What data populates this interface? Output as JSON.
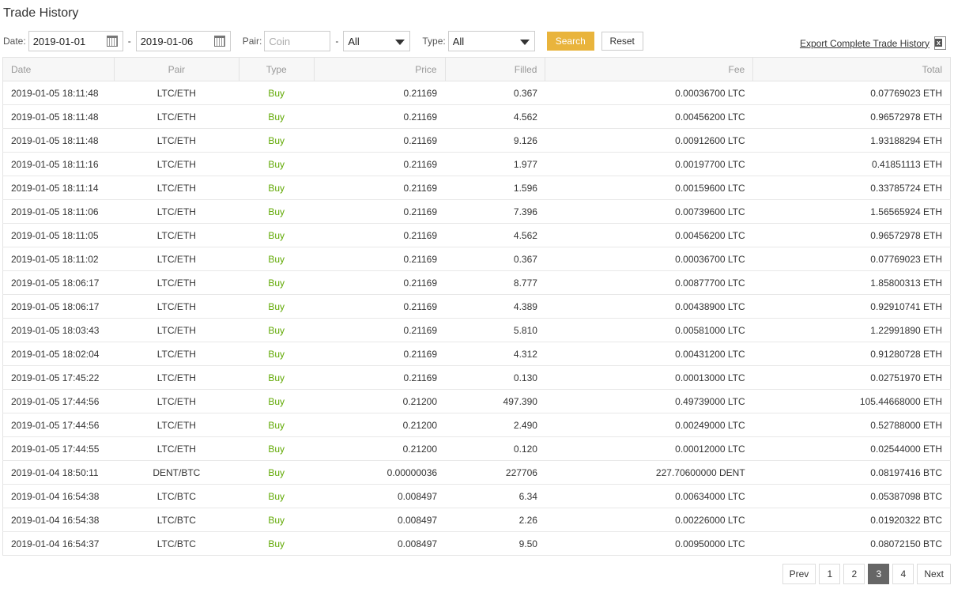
{
  "title": "Trade History",
  "filters": {
    "date_label": "Date:",
    "date_from": "2019-01-01",
    "date_to": "2019-01-06",
    "dash": "-",
    "pair_label": "Pair:",
    "coin_placeholder": "Coin",
    "pair_quote": "All",
    "type_label": "Type:",
    "type_value": "All",
    "search": "Search",
    "reset": "Reset"
  },
  "export_label": "Export Complete Trade History",
  "columns": [
    "Date",
    "Pair",
    "Type",
    "Price",
    "Filled",
    "Fee",
    "Total"
  ],
  "rows": [
    [
      "2019-01-05 18:11:48",
      "LTC/ETH",
      "Buy",
      "0.21169",
      "0.367",
      "0.00036700 LTC",
      "0.07769023 ETH"
    ],
    [
      "2019-01-05 18:11:48",
      "LTC/ETH",
      "Buy",
      "0.21169",
      "4.562",
      "0.00456200 LTC",
      "0.96572978 ETH"
    ],
    [
      "2019-01-05 18:11:48",
      "LTC/ETH",
      "Buy",
      "0.21169",
      "9.126",
      "0.00912600 LTC",
      "1.93188294 ETH"
    ],
    [
      "2019-01-05 18:11:16",
      "LTC/ETH",
      "Buy",
      "0.21169",
      "1.977",
      "0.00197700 LTC",
      "0.41851113 ETH"
    ],
    [
      "2019-01-05 18:11:14",
      "LTC/ETH",
      "Buy",
      "0.21169",
      "1.596",
      "0.00159600 LTC",
      "0.33785724 ETH"
    ],
    [
      "2019-01-05 18:11:06",
      "LTC/ETH",
      "Buy",
      "0.21169",
      "7.396",
      "0.00739600 LTC",
      "1.56565924 ETH"
    ],
    [
      "2019-01-05 18:11:05",
      "LTC/ETH",
      "Buy",
      "0.21169",
      "4.562",
      "0.00456200 LTC",
      "0.96572978 ETH"
    ],
    [
      "2019-01-05 18:11:02",
      "LTC/ETH",
      "Buy",
      "0.21169",
      "0.367",
      "0.00036700 LTC",
      "0.07769023 ETH"
    ],
    [
      "2019-01-05 18:06:17",
      "LTC/ETH",
      "Buy",
      "0.21169",
      "8.777",
      "0.00877700 LTC",
      "1.85800313 ETH"
    ],
    [
      "2019-01-05 18:06:17",
      "LTC/ETH",
      "Buy",
      "0.21169",
      "4.389",
      "0.00438900 LTC",
      "0.92910741 ETH"
    ],
    [
      "2019-01-05 18:03:43",
      "LTC/ETH",
      "Buy",
      "0.21169",
      "5.810",
      "0.00581000 LTC",
      "1.22991890 ETH"
    ],
    [
      "2019-01-05 18:02:04",
      "LTC/ETH",
      "Buy",
      "0.21169",
      "4.312",
      "0.00431200 LTC",
      "0.91280728 ETH"
    ],
    [
      "2019-01-05 17:45:22",
      "LTC/ETH",
      "Buy",
      "0.21169",
      "0.130",
      "0.00013000 LTC",
      "0.02751970 ETH"
    ],
    [
      "2019-01-05 17:44:56",
      "LTC/ETH",
      "Buy",
      "0.21200",
      "497.390",
      "0.49739000 LTC",
      "105.44668000 ETH"
    ],
    [
      "2019-01-05 17:44:56",
      "LTC/ETH",
      "Buy",
      "0.21200",
      "2.490",
      "0.00249000 LTC",
      "0.52788000 ETH"
    ],
    [
      "2019-01-05 17:44:55",
      "LTC/ETH",
      "Buy",
      "0.21200",
      "0.120",
      "0.00012000 LTC",
      "0.02544000 ETH"
    ],
    [
      "2019-01-04 18:50:11",
      "DENT/BTC",
      "Buy",
      "0.00000036",
      "227706",
      "227.70600000 DENT",
      "0.08197416 BTC"
    ],
    [
      "2019-01-04 16:54:38",
      "LTC/BTC",
      "Buy",
      "0.008497",
      "6.34",
      "0.00634000 LTC",
      "0.05387098 BTC"
    ],
    [
      "2019-01-04 16:54:38",
      "LTC/BTC",
      "Buy",
      "0.008497",
      "2.26",
      "0.00226000 LTC",
      "0.01920322 BTC"
    ],
    [
      "2019-01-04 16:54:37",
      "LTC/BTC",
      "Buy",
      "0.008497",
      "9.50",
      "0.00950000 LTC",
      "0.08072150 BTC"
    ]
  ],
  "pagination": {
    "prev": "Prev",
    "pages": [
      "1",
      "2",
      "3",
      "4"
    ],
    "current": "3",
    "next": "Next"
  }
}
